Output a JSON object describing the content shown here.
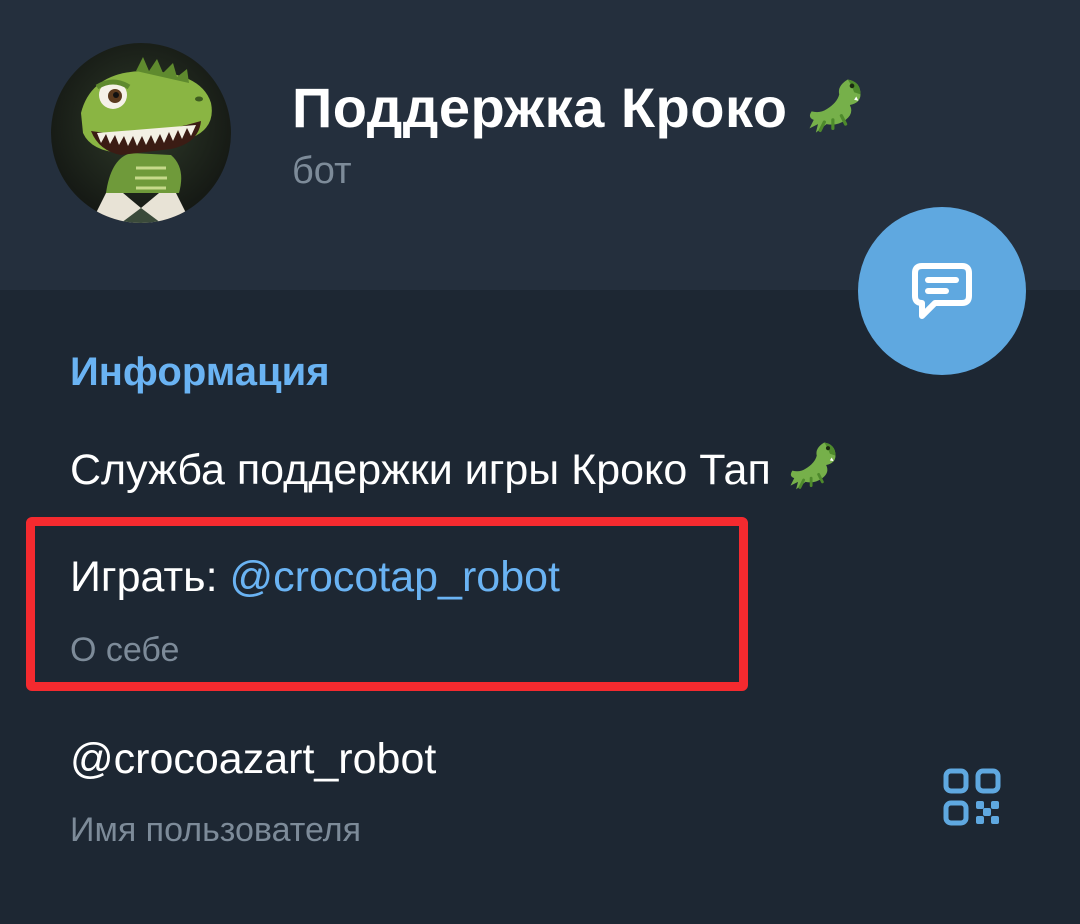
{
  "profile": {
    "name": "Поддержка Кроко",
    "status": "бот",
    "name_emoji": "crocodile-emoji",
    "avatar": "crocodile-avatar"
  },
  "fab": {
    "icon": "message-icon",
    "color": "#5fa8e0"
  },
  "info": {
    "section_title": "Информация",
    "bio_text": "Служба поддержки игры Кроко Тап",
    "bio_emoji": "crocodile-emoji",
    "play_prefix": "Играть: ",
    "play_link": "@crocotap_robot",
    "play_caption": "О себе",
    "username": "@crocoazart_robot",
    "username_caption": "Имя пользователя",
    "qr_icon": "qr-code-icon"
  },
  "colors": {
    "background": "#1d2733",
    "header": "#242f3d",
    "accent": "#6ab3f3",
    "highlight": "#f42a2f",
    "secondary_text": "#7d8b99"
  }
}
